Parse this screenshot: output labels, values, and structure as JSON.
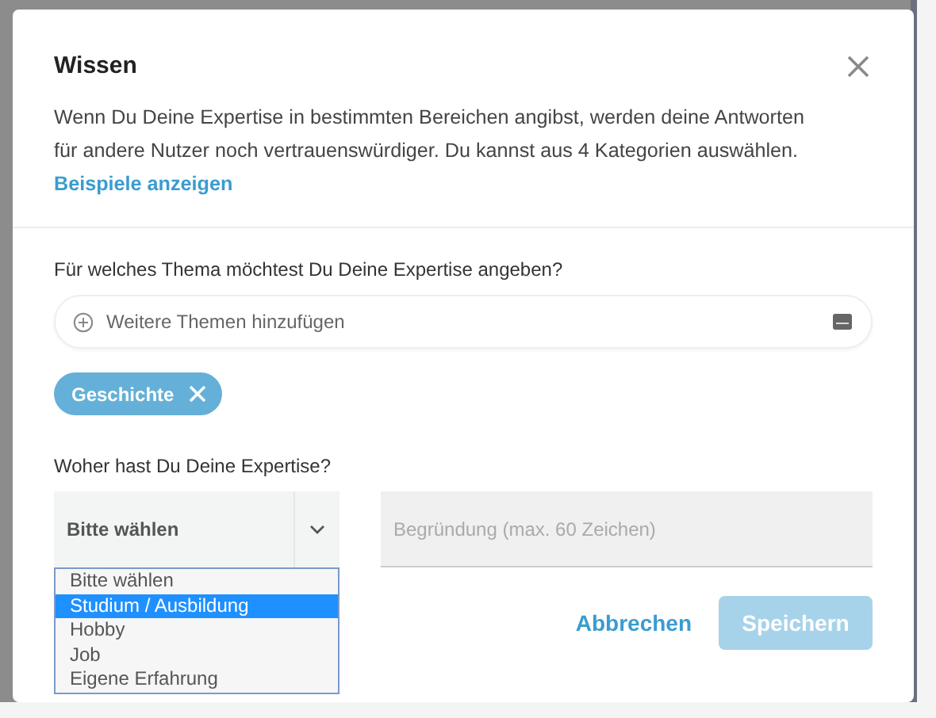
{
  "dialog": {
    "title": "Wissen",
    "description": "Wenn Du Deine Expertise in bestimmten Bereichen angibst, werden deine Antworten für andere Nutzer noch vertrauenswürdiger. Du kannst aus 4 Kategorien auswählen.",
    "link": "Beispiele anzeigen"
  },
  "topic": {
    "label": "Für welches Thema möchtest Du Deine Expertise angeben?",
    "placeholder": "Weitere Themen hinzufügen",
    "tags": [
      {
        "label": "Geschichte"
      }
    ]
  },
  "source": {
    "label": "Woher hast Du Deine Expertise?",
    "select": {
      "value": "Bitte wählen",
      "expanded": true,
      "options": [
        {
          "label": "Bitte wählen",
          "highlighted": false
        },
        {
          "label": "Studium / Ausbildung",
          "highlighted": true
        },
        {
          "label": "Hobby",
          "highlighted": false
        },
        {
          "label": "Job",
          "highlighted": false
        },
        {
          "label": "Eigene Erfahrung",
          "highlighted": false
        }
      ]
    },
    "reason_placeholder": "Begründung (max. 60 Zeichen)"
  },
  "buttons": [
    {
      "label": "Abbrechen",
      "kind": "link",
      "disabled": false
    },
    {
      "label": "Speichern",
      "kind": "primary",
      "disabled": true
    }
  ]
}
